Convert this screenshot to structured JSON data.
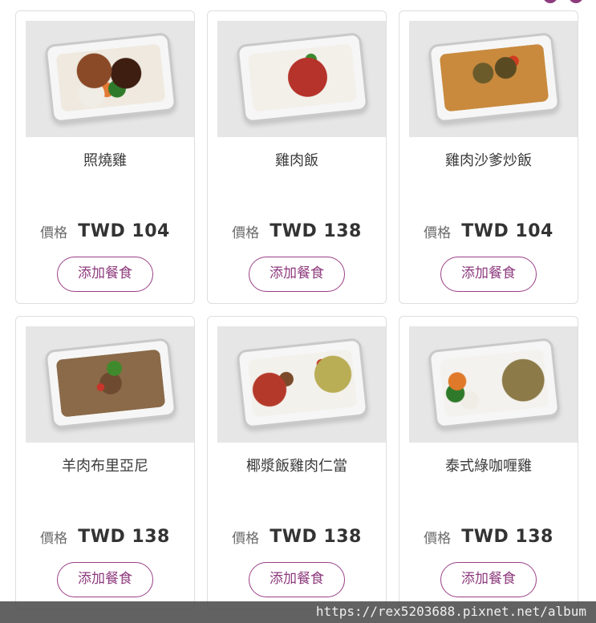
{
  "price_label": "價格",
  "add_button_label": "添加餐食",
  "meals": [
    {
      "name": "照燒雞",
      "price": "TWD 104",
      "food_color": "#6b3a22",
      "accent": "#2f7a2a"
    },
    {
      "name": "雞肉飯",
      "price": "TWD 138",
      "food_color": "#b5332a",
      "accent": "#3a8a2e"
    },
    {
      "name": "雞肉沙爹炒飯",
      "price": "TWD 104",
      "food_color": "#c98a3e",
      "accent": "#d23b20"
    },
    {
      "name": "羊肉布里亞尼",
      "price": "TWD 138",
      "food_color": "#8a6a48",
      "accent": "#3f8a2c"
    },
    {
      "name": "椰漿飯雞肉仁當",
      "price": "TWD 138",
      "food_color": "#c9b250",
      "accent": "#c23a22"
    },
    {
      "name": "泰式綠咖喱雞",
      "price": "TWD 138",
      "food_color": "#9c8a55",
      "accent": "#e07a2a"
    }
  ],
  "watermark": "https://rex5203688.pixnet.net/album"
}
